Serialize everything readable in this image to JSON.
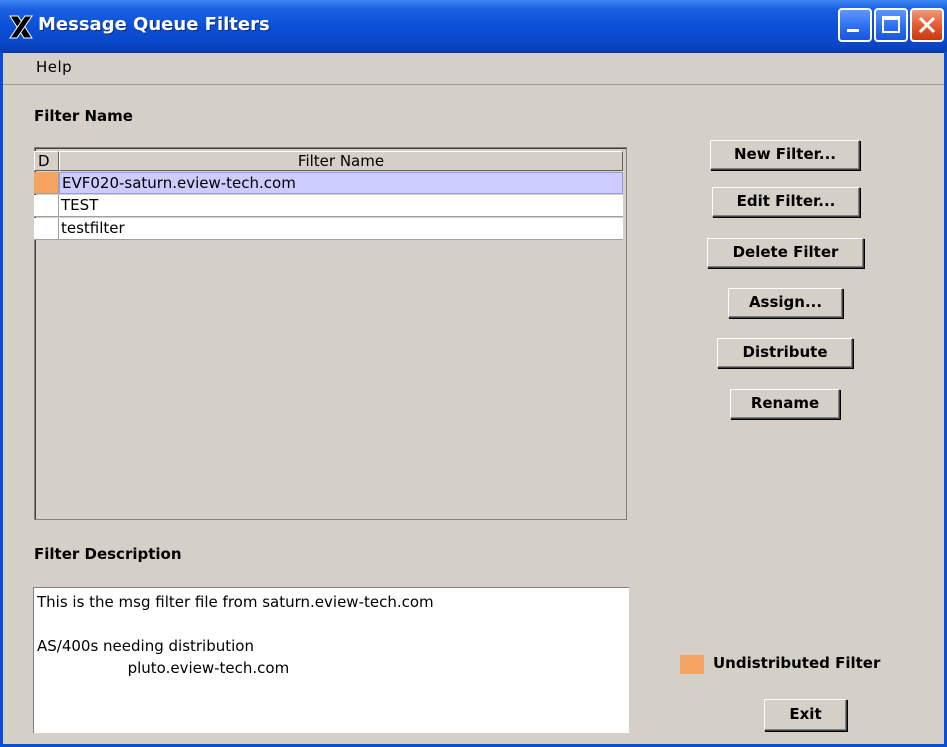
{
  "window": {
    "title": "Message Queue Filters"
  },
  "menu": {
    "help": "Help"
  },
  "filter_section": {
    "label": "Filter Name",
    "columns": [
      "D",
      "Filter Name"
    ],
    "rows": [
      {
        "name": "EVF020-saturn.eview-tech.com",
        "undistributed": true,
        "selected": true
      },
      {
        "name": "TEST",
        "undistributed": false,
        "selected": false
      },
      {
        "name": "testfilter",
        "undistributed": false,
        "selected": false
      }
    ]
  },
  "buttons": {
    "new_filter": "New Filter...",
    "edit_filter": "Edit Filter...",
    "delete_filter": "Delete Filter",
    "assign": "Assign...",
    "distribute": "Distribute",
    "rename": "Rename",
    "exit": "Exit"
  },
  "description_section": {
    "label": "Filter Description",
    "text": "This is the msg filter file from saturn.eview-tech.com\n\nAS/400s needing distribution\n                   pluto.eview-tech.com"
  },
  "legend": {
    "label": "Undistributed Filter",
    "color": "#f4a460"
  },
  "colors": {
    "titlebar": "#0a4ed6",
    "selection": "#ccccff",
    "background": "#d4d0c8"
  }
}
